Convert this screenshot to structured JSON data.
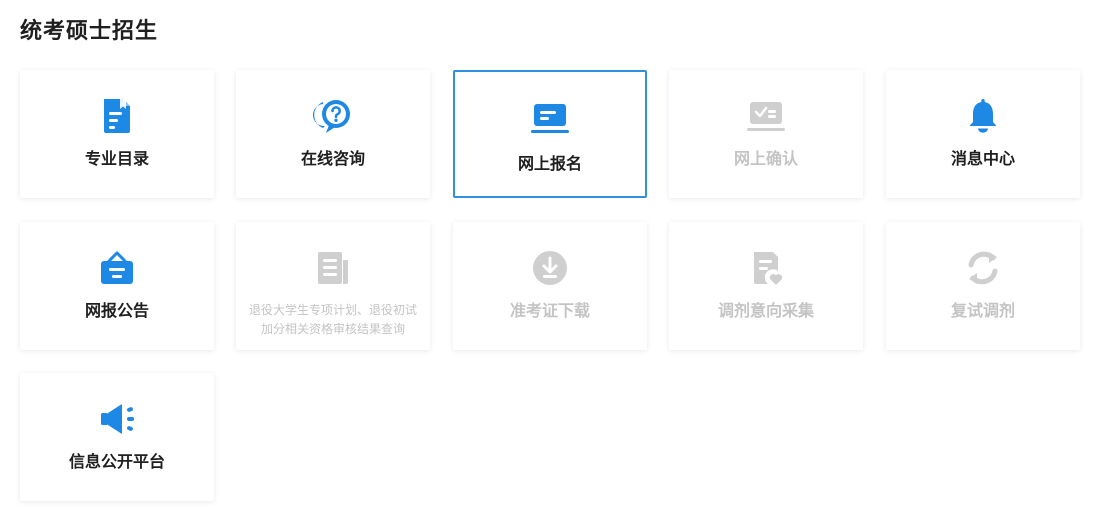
{
  "page": {
    "title": "统考硕士招生"
  },
  "colors": {
    "active_icon": "#1e88e5",
    "disabled_icon": "#cfcfcf",
    "selected_border": "#2f8fe0",
    "active_text": "#1f1f1f",
    "disabled_text": "#c4c4c4"
  },
  "tiles": [
    {
      "label": "专业目录",
      "icon": "document-bookmark-icon",
      "state": "enabled"
    },
    {
      "label": "在线咨询",
      "icon": "question-chat-icon",
      "state": "enabled"
    },
    {
      "label": "网上报名",
      "icon": "laptop-form-icon",
      "state": "selected"
    },
    {
      "label": "网上确认",
      "icon": "laptop-check-icon",
      "state": "disabled"
    },
    {
      "label": "消息中心",
      "icon": "bell-icon",
      "state": "enabled"
    },
    {
      "label": "网报公告",
      "icon": "notice-board-icon",
      "state": "enabled"
    },
    {
      "label": "退役大学生专项计划、退役初试加分相关资格审核结果查询",
      "icon": "newspaper-icon",
      "state": "disabled"
    },
    {
      "label": "准考证下载",
      "icon": "download-circle-icon",
      "state": "disabled"
    },
    {
      "label": "调剂意向采集",
      "icon": "document-heart-icon",
      "state": "disabled"
    },
    {
      "label": "复试调剂",
      "icon": "refresh-icon",
      "state": "disabled"
    },
    {
      "label": "信息公开平台",
      "icon": "megaphone-icon",
      "state": "enabled"
    }
  ]
}
